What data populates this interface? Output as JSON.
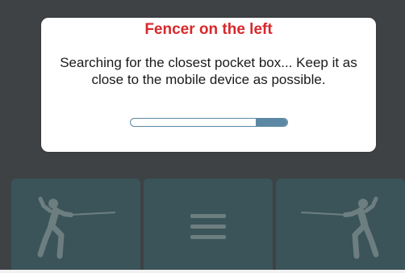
{
  "dialog": {
    "title": "Fencer on the left",
    "message": "Searching for the closest pocket box... Keep it as close to the mobile device as possible.",
    "progress_fraction": 0.2
  },
  "controls": {
    "left_icon": "fencer-left-icon",
    "menu_icon": "hamburger-menu-icon",
    "right_icon": "fencer-right-icon"
  },
  "colors": {
    "background": "#3e4244",
    "title": "#d7282c",
    "progress": "#5c88a3",
    "control": "#3a5459",
    "icon": "#6d7e81"
  }
}
